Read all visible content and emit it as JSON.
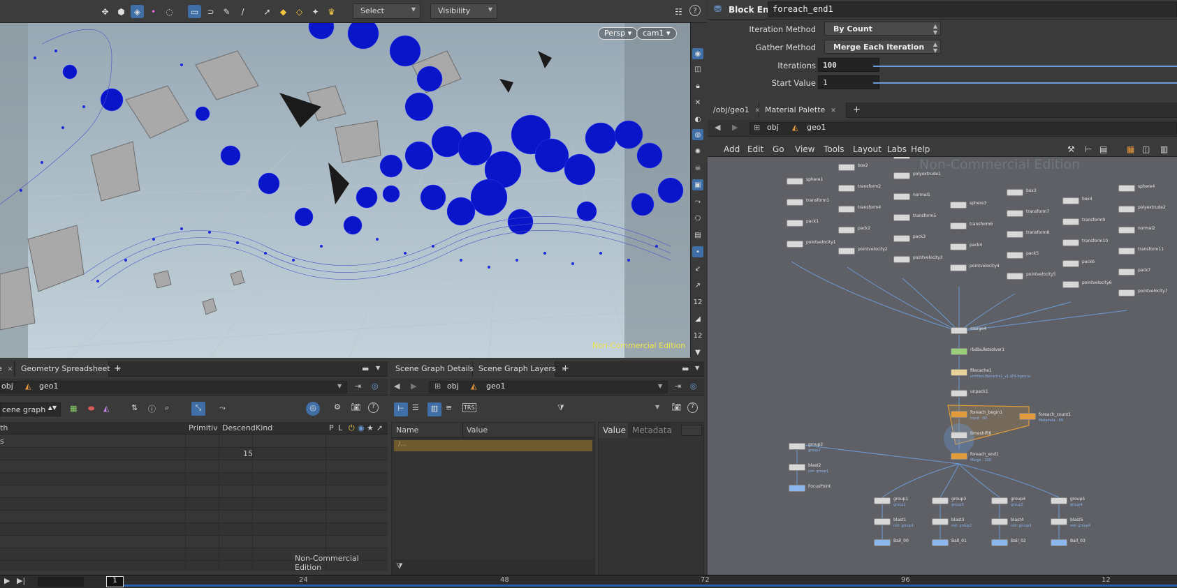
{
  "toolbar": {
    "select_label": "Select",
    "visibility_label": "Visibility"
  },
  "viewport": {
    "persp_label": "Persp",
    "cam_label": "cam1",
    "watermark": "Non-Commercial Edition"
  },
  "left_pane": {
    "tabs": [
      {
        "label": "e"
      },
      {
        "label": "Geometry Spreadsheet"
      }
    ],
    "path_obj": "obj",
    "path_geo": "geo1",
    "mode": "cene graph",
    "columns": [
      "th",
      "Primitiv",
      "Descend",
      "Kind",
      "P",
      "L"
    ],
    "rows": [
      {
        "path": "s",
        "descend": ""
      },
      {
        "path": "",
        "descend": "15"
      }
    ],
    "watermark": "Non-Commercial Edition"
  },
  "mid_pane": {
    "tabs": [
      {
        "label": "Scene Graph Details"
      },
      {
        "label": "Scene Graph Layers"
      }
    ],
    "path_obj": "obj",
    "path_geo": "geo1",
    "columns": [
      "Name",
      "Value"
    ],
    "row1": "/...",
    "right_tabs": [
      "Value",
      "Metadata"
    ]
  },
  "params": {
    "node_type": "Block End",
    "node_name": "foreach_end1",
    "iteration_method_label": "Iteration Method",
    "iteration_method": "By Count",
    "gather_method_label": "Gather Method",
    "gather_method": "Merge Each Iteration",
    "iterations_label": "Iterations",
    "iterations": "100",
    "start_value_label": "Start Value",
    "start_value": "1"
  },
  "network": {
    "tabs": [
      {
        "label": "/obj/geo1"
      },
      {
        "label": "Material Palette"
      }
    ],
    "path_obj": "obj",
    "path_geo": "geo1",
    "menu": [
      "Add",
      "Edit",
      "Go",
      "View",
      "Tools",
      "Layout",
      "Labs",
      "Help"
    ],
    "watermark": "Non-Commercial Edition",
    "nodes": [
      {
        "name": "sphere1"
      },
      {
        "name": "transform1"
      },
      {
        "name": "pack1"
      },
      {
        "name": "pointvelocity1"
      },
      {
        "name": "box2"
      },
      {
        "name": "transform2"
      },
      {
        "name": "transform4"
      },
      {
        "name": "pack2"
      },
      {
        "name": "pointvelocity2"
      },
      {
        "name": "sphere2"
      },
      {
        "name": "polyextrude1"
      },
      {
        "name": "normal1"
      },
      {
        "name": "transform5"
      },
      {
        "name": "pack3"
      },
      {
        "name": "pointvelocity3"
      },
      {
        "name": "sphere3"
      },
      {
        "name": "transform6"
      },
      {
        "name": "pack4"
      },
      {
        "name": "pointvelocity4"
      },
      {
        "name": "box3"
      },
      {
        "name": "transform7"
      },
      {
        "name": "transform8"
      },
      {
        "name": "pack5"
      },
      {
        "name": "pointvelocity5"
      },
      {
        "name": "box4"
      },
      {
        "name": "transform9"
      },
      {
        "name": "transform10"
      },
      {
        "name": "pack6"
      },
      {
        "name": "pointvelocity6"
      },
      {
        "name": "sphere4"
      },
      {
        "name": "polyextrude2"
      },
      {
        "name": "normal2"
      },
      {
        "name": "transform11"
      },
      {
        "name": "pack7"
      },
      {
        "name": "pointvelocity7"
      },
      {
        "name": "merge4"
      },
      {
        "name": "rbdbulletsolver1"
      },
      {
        "name": "filecache1"
      },
      {
        "name": "unpack1"
      },
      {
        "name": "foreach_begin1"
      },
      {
        "name": "foreach_count1"
      },
      {
        "name": "timeshift6"
      },
      {
        "name": "foreach_end1"
      },
      {
        "name": "group2"
      },
      {
        "name": "blast2"
      },
      {
        "name": "FocusPoint"
      },
      {
        "name": "group1"
      },
      {
        "name": "blast1"
      },
      {
        "name": "Ball_00"
      },
      {
        "name": "group3"
      },
      {
        "name": "blast3"
      },
      {
        "name": "Ball_01"
      },
      {
        "name": "group4"
      },
      {
        "name": "blast4"
      },
      {
        "name": "Ball_02"
      },
      {
        "name": "group5"
      },
      {
        "name": "blast5"
      },
      {
        "name": "Ball_03"
      }
    ],
    "subs": {
      "filecache": "untitled.filecache1_v1.$F4.bgeo.sc",
      "foreach_begin": "Input : 00",
      "foreach_count": "Metadata : 99",
      "foreach_end": "Merge : 100",
      "group2": "group2",
      "blast2": "not: group1",
      "group1": "group1",
      "blast1": "not: group1",
      "group3": "group3",
      "blast3": "not: group2",
      "group4": "group3",
      "blast4": "not: group3",
      "group5": "group4",
      "blast5": "not: group4"
    }
  },
  "timeline": {
    "frame": "1",
    "ticks": [
      "24",
      "48",
      "72",
      "96",
      "12"
    ]
  }
}
